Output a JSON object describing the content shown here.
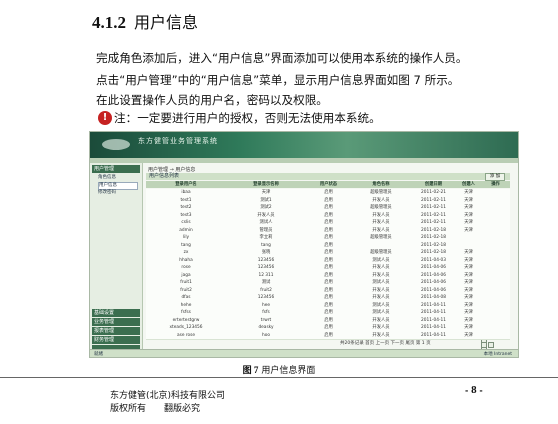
{
  "section": {
    "number": "4.1.2",
    "title": "用户信息"
  },
  "paragraphs": [
    "完成角色添加后，进入“用户信息”界面添加可以使用本系统的操作人员。",
    "点击“用户管理”中的“用户信息”菜单，显示用户信息界面如图 7 所示。",
    "在此设置操作人员的用户名，密码以及权限。"
  ],
  "note": {
    "icon": "exclamation-icon",
    "text": "注：一定要进行用户的授权，否则无法使用本系统。"
  },
  "screenshot": {
    "system_name": "东方健管业务管理系统",
    "sidebar_groups": [
      "用户管理",
      "基础设置",
      "业务管理",
      "报表管理",
      "财务管理",
      "统计查询"
    ],
    "sidebar_items": [
      "角色信息",
      "用户信息",
      "修改密码"
    ],
    "breadcrumb": "用户管理 → 用户信息",
    "table_title": "用户信息列表",
    "add_button": "添 加",
    "columns": [
      "登录用户名",
      "登录显示名称",
      "用户状态",
      "角色名称",
      "创建日期",
      "创建人",
      "操作"
    ],
    "rows": [
      [
        "ibaa",
        "天津",
        "启用",
        "超级管理员",
        "2011-02-21",
        "天津"
      ],
      [
        "test1",
        "测试1",
        "启用",
        "开发人员",
        "2011-02-11",
        "天津"
      ],
      [
        "test2",
        "测试2",
        "启用",
        "超级管理员",
        "2011-02-11",
        "天津"
      ],
      [
        "test3",
        "开发人员",
        "启用",
        "开发人员",
        "2011-02-11",
        "天津"
      ],
      [
        "cslis",
        "测试人",
        "启用",
        "开发人员",
        "2011-02-11",
        "天津"
      ],
      [
        "admin",
        "管理员",
        "启用",
        "开发人员",
        "2011-02-18",
        "天津"
      ],
      [
        "lily",
        "李立莉",
        "启用",
        "超级管理员",
        "2011-02-18",
        ""
      ],
      [
        "tang",
        "tang",
        "启用",
        "",
        "2011-02-18",
        ""
      ],
      [
        "zx",
        "张晓",
        "启用",
        "超级管理员",
        "2011-02-18",
        "天津"
      ],
      [
        "hhaha",
        "123456",
        "启用",
        "测试人员",
        "2011-04-03",
        "天津"
      ],
      [
        "rose",
        "123456",
        "启用",
        "开发人员",
        "2011-04-06",
        "天津"
      ],
      [
        "jaga",
        "12 311",
        "启用",
        "开发人员",
        "2011-04-06",
        "天津"
      ],
      [
        "fruit1",
        "测试",
        "启用",
        "测试人员",
        "2011-04-06",
        "天津"
      ],
      [
        "fruit2",
        "fruit2",
        "启用",
        "开发人员",
        "2011-04-06",
        "天津"
      ],
      [
        "dfas",
        "123456",
        "启用",
        "开发人员",
        "2011-04-08",
        "天津"
      ],
      [
        "hehe",
        "hee",
        "启用",
        "测试人员",
        "2011-04-11",
        "天津"
      ],
      [
        "fsfss",
        "fsfs",
        "启用",
        "测试人员",
        "2011-04-11",
        "天津"
      ],
      [
        "ertertestgrw",
        "trwrt",
        "启用",
        "开发人员",
        "2011-04-11",
        "天津"
      ],
      [
        "xteads_123456",
        "deasky",
        "启用",
        "开发人员",
        "2011-04-11",
        "天津"
      ],
      [
        "ase rose",
        "hoo",
        "启用",
        "开发人员",
        "2011-04-11",
        "天津"
      ]
    ],
    "pager": "共20条记录 首页 上一页 下一页 尾页 第 1 页",
    "status_left": "就绪",
    "status_right": "本地 Intranet"
  },
  "caption": {
    "label": "图 7",
    "text": "用户信息界面"
  },
  "footer": {
    "company": "东方健管(北京)科技有限公司",
    "rights": "版权所有",
    "rights2": "翻版必究",
    "page": "8"
  }
}
